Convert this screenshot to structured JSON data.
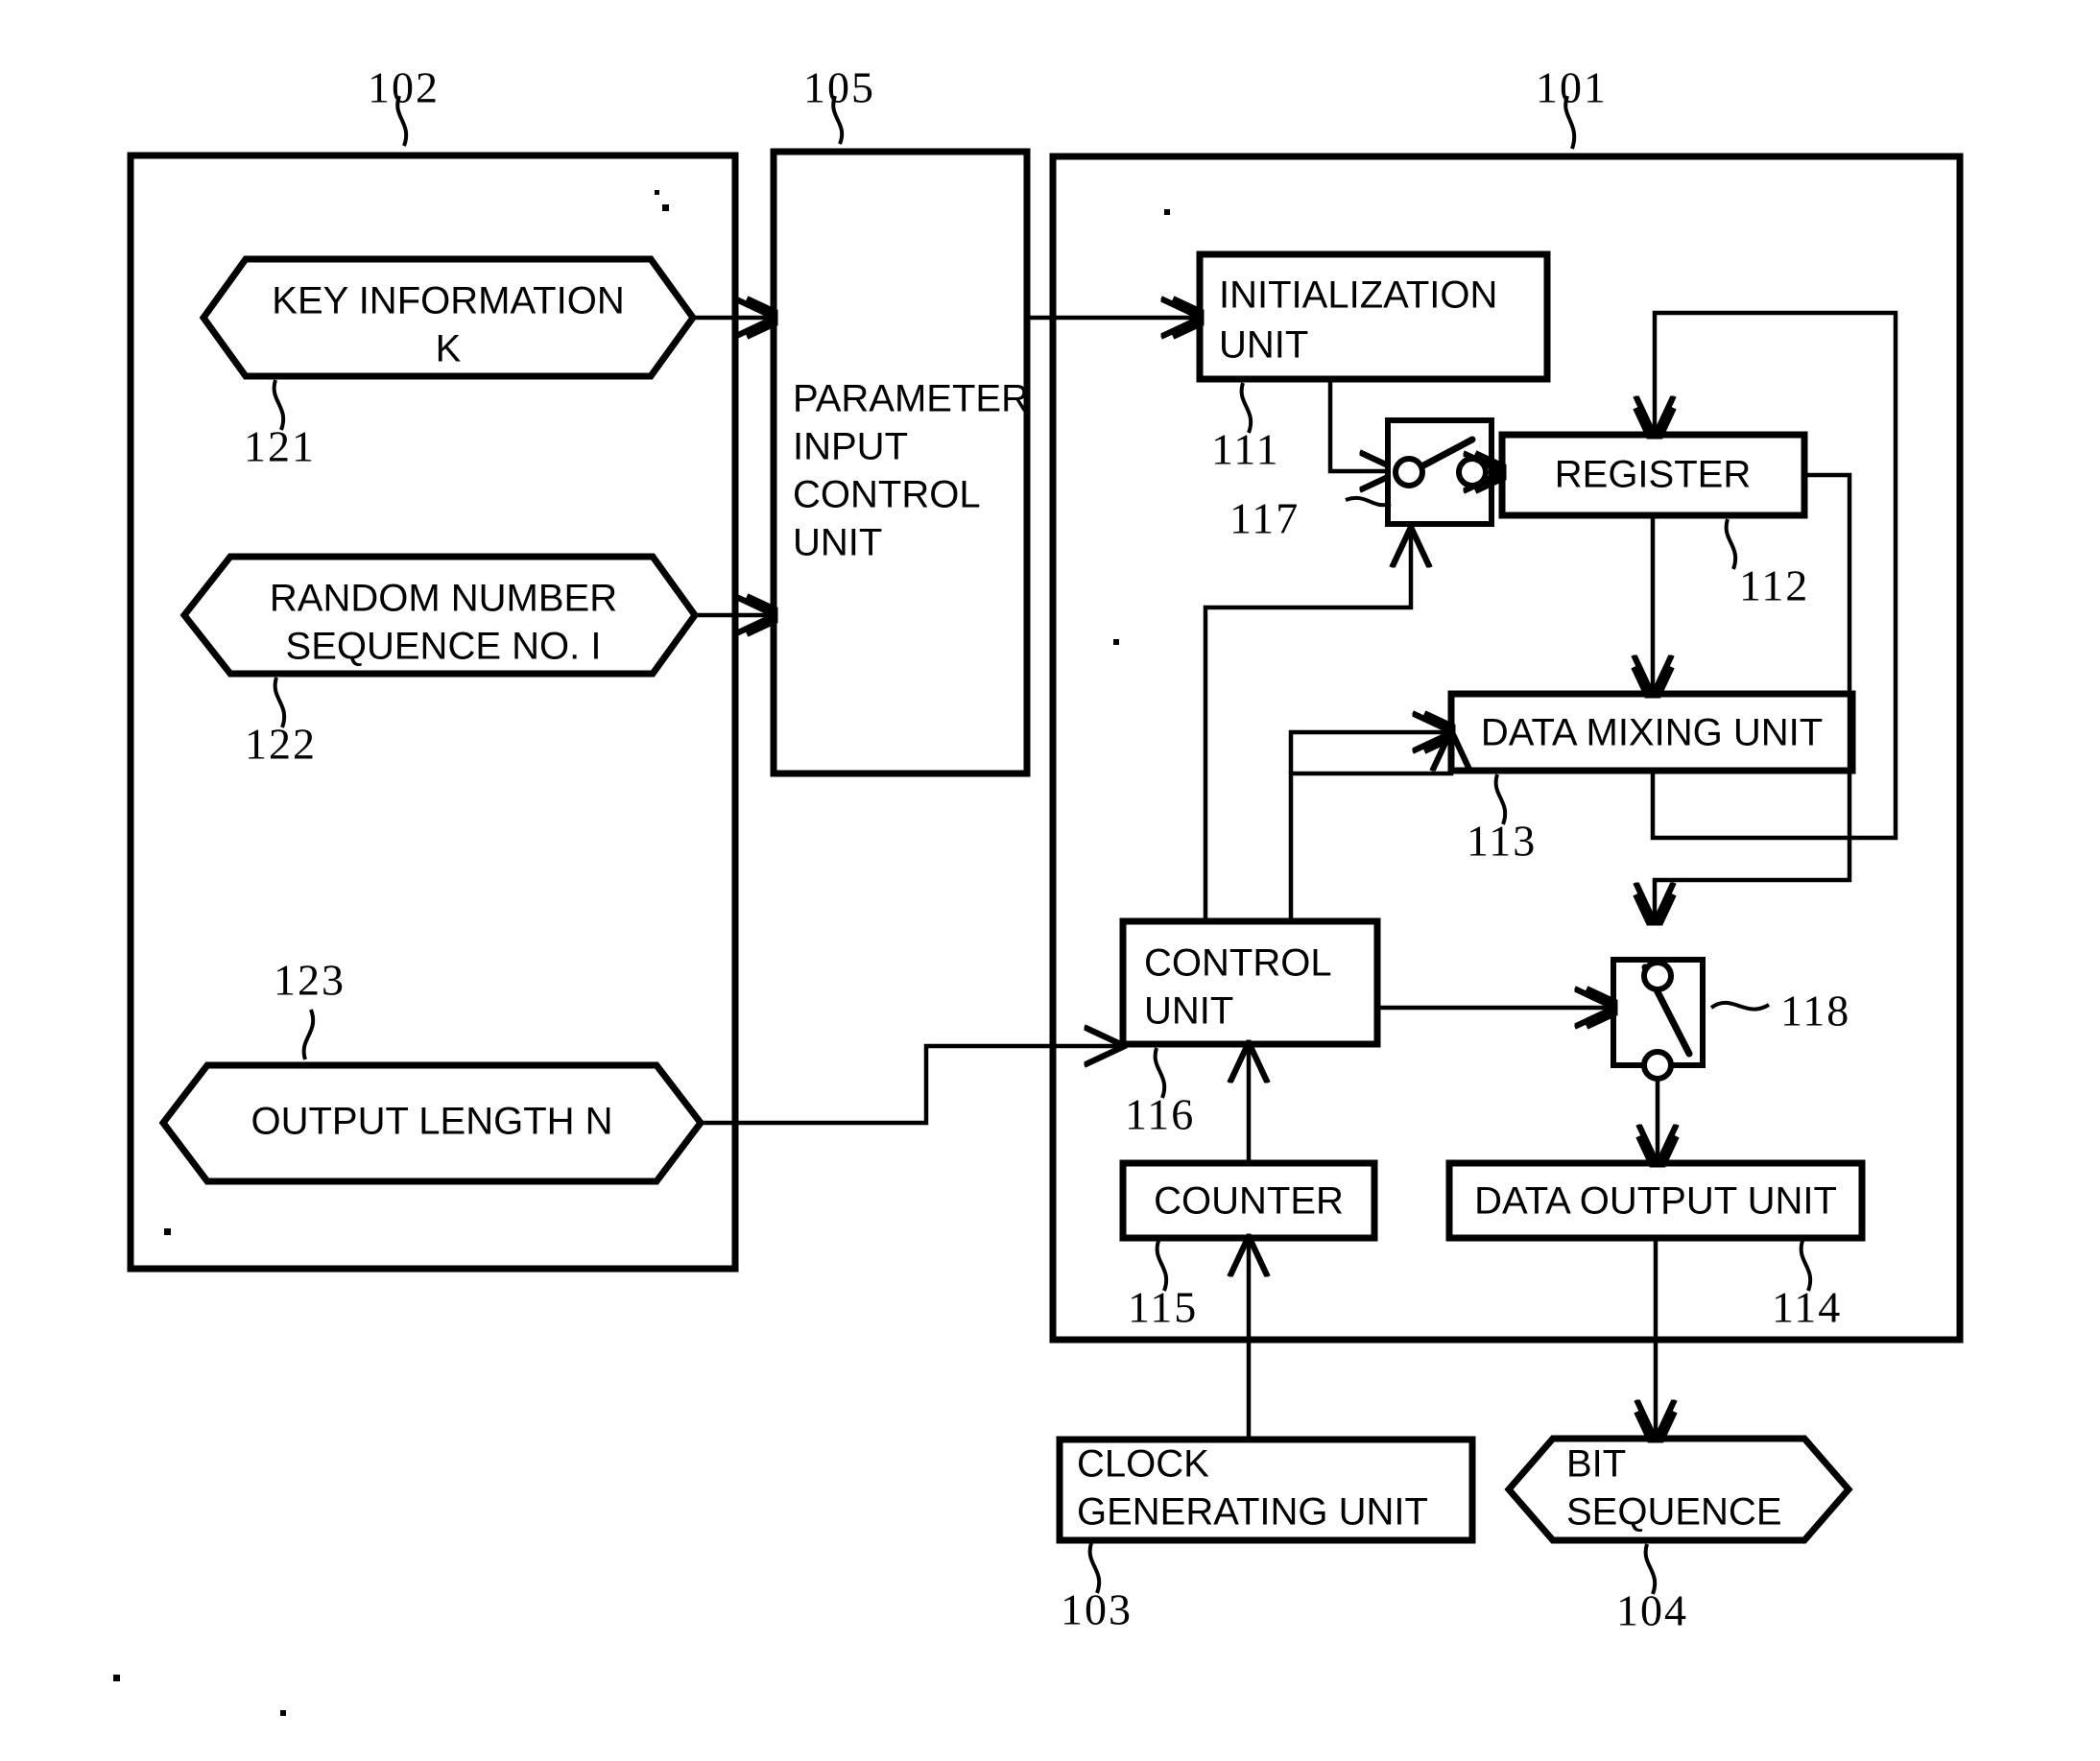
{
  "figure": {
    "title": "Random number generating apparatus block diagram",
    "outer_blocks": [
      {
        "ref": "102",
        "name": "input-parameter-enclosure"
      },
      {
        "ref": "105",
        "name": "parameter-input-control-unit"
      },
      {
        "ref": "101",
        "name": "random-number-generator-enclosure"
      }
    ]
  },
  "references": {
    "r101": "101",
    "r102": "102",
    "r103": "103",
    "r104": "104",
    "r105": "105",
    "r111": "111",
    "r112": "112",
    "r113": "113",
    "r114": "114",
    "r115": "115",
    "r116": "116",
    "r117": "117",
    "r118": "118",
    "r121": "121",
    "r122": "122",
    "r123": "123"
  },
  "blocks": {
    "parameter_input_control_unit": {
      "lines": [
        "PARAMETER",
        "INPUT",
        "CONTROL",
        "UNIT"
      ],
      "line1": "PARAMETER",
      "line2": "INPUT",
      "line3": "CONTROL",
      "line4": "UNIT"
    },
    "initialization_unit": {
      "line1": "INITIALIZATION",
      "line2": "UNIT"
    },
    "register": {
      "label": "REGISTER"
    },
    "data_mixing_unit": {
      "label": "DATA MIXING UNIT"
    },
    "control_unit": {
      "line1": "CONTROL",
      "line2": "UNIT"
    },
    "counter": {
      "label": "COUNTER"
    },
    "data_output_unit": {
      "label": "DATA OUTPUT UNIT"
    },
    "clock_generating_unit": {
      "line1": "CLOCK",
      "line2": "GENERATING UNIT"
    }
  },
  "hexagons": {
    "key_information": {
      "line1": "KEY INFORMATION",
      "line2": "K"
    },
    "random_number_sequence": {
      "line1": "RANDOM NUMBER",
      "line2": "SEQUENCE NO. I"
    },
    "output_length": {
      "line1": "OUTPUT LENGTH N"
    },
    "bit_sequence": {
      "line1": "BIT",
      "line2": "SEQUENCE"
    }
  },
  "switches": {
    "sw117": {
      "ref": "117",
      "orientation": "horizontal"
    },
    "sw118": {
      "ref": "118",
      "orientation": "vertical"
    }
  },
  "colors": {
    "ink": "#000000",
    "paper": "#ffffff"
  }
}
